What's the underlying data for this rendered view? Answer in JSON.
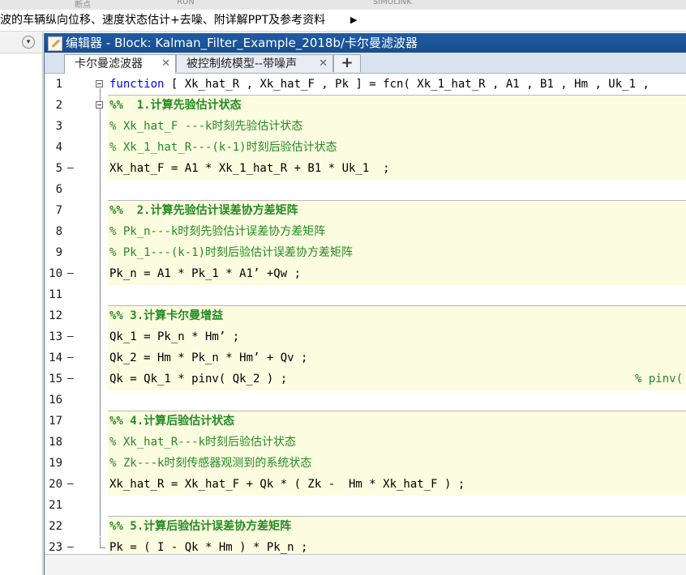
{
  "toolstrip": {
    "labels": [
      "断点",
      "RUN",
      "SIMULINK"
    ]
  },
  "breadcrumb": {
    "text": "波的车辆纵向位移、速度状态估计+去噪、附详解PPT及参考资料",
    "arrow": "▶"
  },
  "left_panel": {
    "menu_icon": "▾"
  },
  "editor": {
    "title": "编辑器 - Block: Kalman_Filter_Example_2018b/卡尔曼滤波器",
    "tabs": [
      {
        "label": "卡尔曼滤波器",
        "close": "✕"
      },
      {
        "label": "被控制统模型--带噪声",
        "close": "✕"
      }
    ],
    "add_tab": "+",
    "lines": [
      {
        "n": "1",
        "exec": "",
        "kw": "function",
        "text": " [ Xk_hat_R , Xk_hat_F , Pk ] = fcn( Xk_1_hat_R , A1 , B1 , Hm , Uk_1 ,"
      },
      {
        "n": "2",
        "exec": "",
        "text": "%%  1.计算先验估计状态"
      },
      {
        "n": "3",
        "exec": "",
        "text": "% Xk_hat_F ---k时刻先验估计状态"
      },
      {
        "n": "4",
        "exec": "",
        "text": "% Xk_1_hat_R---(k-1)时刻后验估计状态"
      },
      {
        "n": "5",
        "exec": "—",
        "text": "Xk_hat_F = A1 * Xk_1_hat_R + B1 * Uk_1  ;"
      },
      {
        "n": "6",
        "exec": "",
        "text": ""
      },
      {
        "n": "7",
        "exec": "",
        "text": "%%  2.计算先验估计误差协方差矩阵"
      },
      {
        "n": "8",
        "exec": "",
        "text": "% Pk_n---k时刻先验估计误差协方差矩阵"
      },
      {
        "n": "9",
        "exec": "",
        "text": "% Pk_1---(k-1)时刻后验估计误差协方差矩阵"
      },
      {
        "n": "10",
        "exec": "—",
        "text": "Pk_n = A1 * Pk_1 * A1’ +Qw ;"
      },
      {
        "n": "11",
        "exec": "",
        "text": ""
      },
      {
        "n": "12",
        "exec": "",
        "text": "%% 3.计算卡尔曼增益"
      },
      {
        "n": "13",
        "exec": "—",
        "text": "Qk_1 = Pk_n * Hm’ ;"
      },
      {
        "n": "14",
        "exec": "—",
        "text": "Qk_2 = Hm * Pk_n * Hm’ + Qv ;"
      },
      {
        "n": "15",
        "exec": "—",
        "text": "Qk = Qk_1 * pinv( Qk_2 ) ;",
        "trailing_comment": "% pinv("
      },
      {
        "n": "16",
        "exec": "",
        "text": ""
      },
      {
        "n": "17",
        "exec": "",
        "text": "%% 4.计算后验估计状态"
      },
      {
        "n": "18",
        "exec": "",
        "text": "% Xk_hat_R---k时刻后验估计状态"
      },
      {
        "n": "19",
        "exec": "",
        "text": "% Zk---k时刻传感器观测到的系统状态"
      },
      {
        "n": "20",
        "exec": "—",
        "text": "Xk_hat_R = Xk_hat_F + Qk * ( Zk -  Hm * Xk_hat_F ) ;"
      },
      {
        "n": "21",
        "exec": "",
        "text": ""
      },
      {
        "n": "22",
        "exec": "",
        "text": "%% 5.计算后验估计误差协方差矩阵"
      },
      {
        "n": "23",
        "exec": "—",
        "text": "Pk = ( I - Qk * Hm ) * Pk_n ;"
      }
    ]
  },
  "colors": {
    "title_bar": "#1f5ca6",
    "cell_band": "#fcfce0",
    "comment": "#228b22",
    "keyword": "#0000ff"
  }
}
